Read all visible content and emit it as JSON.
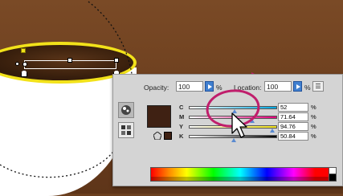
{
  "panel": {
    "opacity_label": "Opacity:",
    "opacity_value": "100",
    "location_label": "Location:",
    "location_value": "100",
    "percent": "%",
    "menu_icon": "menu-icon"
  },
  "cmyk": [
    {
      "label": "C",
      "value": "52",
      "unit": "%",
      "fraction": 0.52,
      "gradient": [
        "#ffffff",
        "#00a6e0"
      ]
    },
    {
      "label": "M",
      "value": "71.64",
      "unit": "%",
      "fraction": 0.7164,
      "gradient": [
        "#ffffff",
        "#e2007a"
      ]
    },
    {
      "label": "Y",
      "value": "94.76",
      "unit": "%",
      "fraction": 0.9476,
      "gradient": [
        "#ffffff",
        "#f2e21a"
      ]
    },
    {
      "label": "K",
      "value": "50.84",
      "unit": "%",
      "fraction": 0.5084,
      "gradient": [
        "#ffffff",
        "#000000"
      ]
    }
  ],
  "colors": {
    "selected_swatch": "#3f2113",
    "highlight": "#c01e6c",
    "accent": "#3f7fd0"
  },
  "icons": [
    "color-wheel-icon",
    "swatches-icon",
    "out-of-gamut-icon",
    "arrow-cursor-icon",
    "pink-arrow-icon"
  ]
}
